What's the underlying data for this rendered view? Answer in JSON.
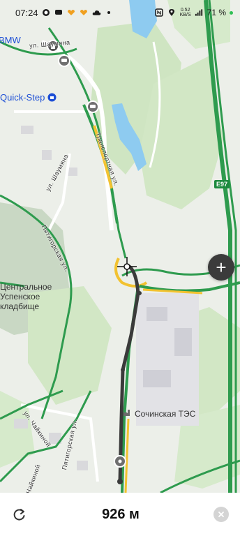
{
  "status_bar": {
    "time": "07:24",
    "speed_value": "0.52",
    "speed_unit": "KB/S",
    "battery": "71 %"
  },
  "map": {
    "poi_bmw": "BMW",
    "poi_quickstep": "Quick-Step",
    "poi_tes": "Сочинская ТЭС",
    "area_cemetery_line1": "Центральное",
    "area_cemetery_line2": "Успенское",
    "area_cemetery_line3": "кладбище",
    "street_shaumyana_top": "ул. Шаумяна",
    "street_shaumyana_mid": "ул. Шаумяна",
    "street_transport": "Транспортная ул.",
    "street_pyatigorskaya_top": "Пятигорская ул.",
    "street_pyatigorskaya_bottom": "Пятигорская ул.",
    "street_chaykinoy": "ул. Чайкиной",
    "street_chaykinoy_bottom": "Чайкиной",
    "road_shield": "E97",
    "road_shield_color": "#1c8a3e",
    "route_color": "#3a3a3a",
    "highway_color": "#2e9b4e",
    "traffic_yellow": "#f2c230"
  },
  "controls": {
    "zoom_in": "+"
  },
  "bottom_bar": {
    "distance": "926 м"
  }
}
